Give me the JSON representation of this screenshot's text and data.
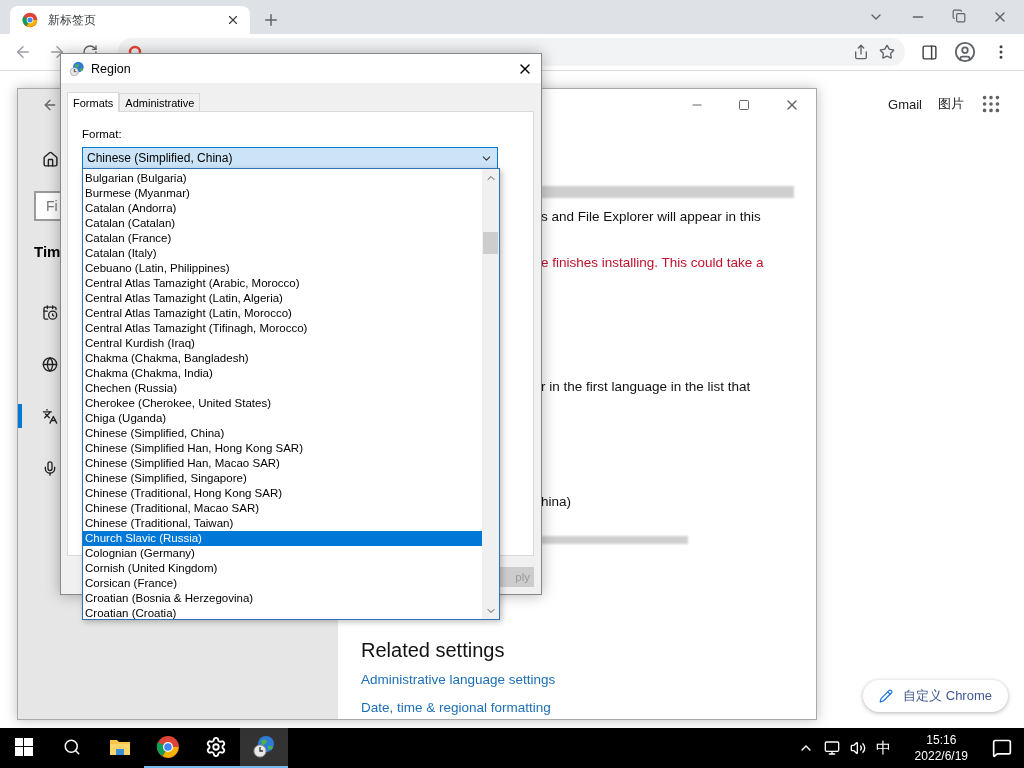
{
  "browser": {
    "tab": {
      "title": "新标签页",
      "selected": true
    },
    "top_links": [
      "Gmail",
      "图片"
    ],
    "customize_button": "自定义 Chrome"
  },
  "settings_window": {
    "search": {
      "placeholder": "Fi"
    },
    "heading": "Tim",
    "nav_items": [
      {
        "kind": "calendar",
        "selected": false
      },
      {
        "kind": "globe",
        "selected": false
      },
      {
        "kind": "language",
        "selected": true
      },
      {
        "kind": "microphone",
        "selected": false
      }
    ],
    "paragraphs": [
      {
        "text": "s and File Explorer will appear in this",
        "warning": false
      },
      {
        "text": "e finishes installing. This could take a",
        "warning": true
      },
      {
        "text": "r in the first language in the list that",
        "warning": false
      },
      {
        "text": "hina)",
        "warning": false
      }
    ],
    "related_settings": {
      "title": "Related settings",
      "links": [
        "Administrative language settings",
        "Date, time & regional formatting"
      ]
    }
  },
  "region_dialog": {
    "title": "Region",
    "tabs": [
      {
        "label": "Formats",
        "selected": true
      },
      {
        "label": "Administrative",
        "selected": false
      }
    ],
    "format_label": "Format:",
    "format_value": "Chinese (Simplified, China)",
    "apply_button": {
      "label": "ply",
      "disabled": true
    }
  },
  "format_list": [
    {
      "label": "Bulgarian (Bulgaria)",
      "selected": false
    },
    {
      "label": "Burmese (Myanmar)",
      "selected": false
    },
    {
      "label": "Catalan (Andorra)",
      "selected": false
    },
    {
      "label": "Catalan (Catalan)",
      "selected": false
    },
    {
      "label": "Catalan (France)",
      "selected": false
    },
    {
      "label": "Catalan (Italy)",
      "selected": false
    },
    {
      "label": "Cebuano (Latin, Philippines)",
      "selected": false
    },
    {
      "label": "Central Atlas Tamazight (Arabic, Morocco)",
      "selected": false
    },
    {
      "label": "Central Atlas Tamazight (Latin, Algeria)",
      "selected": false
    },
    {
      "label": "Central Atlas Tamazight (Latin, Morocco)",
      "selected": false
    },
    {
      "label": "Central Atlas Tamazight (Tifinagh, Morocco)",
      "selected": false
    },
    {
      "label": "Central Kurdish (Iraq)",
      "selected": false
    },
    {
      "label": "Chakma (Chakma, Bangladesh)",
      "selected": false
    },
    {
      "label": "Chakma (Chakma, India)",
      "selected": false
    },
    {
      "label": "Chechen (Russia)",
      "selected": false
    },
    {
      "label": "Cherokee (Cherokee, United States)",
      "selected": false
    },
    {
      "label": "Chiga (Uganda)",
      "selected": false
    },
    {
      "label": "Chinese (Simplified, China)",
      "selected": false
    },
    {
      "label": "Chinese (Simplified Han, Hong Kong SAR)",
      "selected": false
    },
    {
      "label": "Chinese (Simplified Han, Macao SAR)",
      "selected": false
    },
    {
      "label": "Chinese (Simplified, Singapore)",
      "selected": false
    },
    {
      "label": "Chinese (Traditional, Hong Kong SAR)",
      "selected": false
    },
    {
      "label": "Chinese (Traditional, Macao SAR)",
      "selected": false
    },
    {
      "label": "Chinese (Traditional, Taiwan)",
      "selected": false
    },
    {
      "label": "Church Slavic (Russia)",
      "selected": true
    },
    {
      "label": "Colognian (Germany)",
      "selected": false
    },
    {
      "label": "Cornish (United Kingdom)",
      "selected": false
    },
    {
      "label": "Corsican (France)",
      "selected": false
    },
    {
      "label": "Croatian (Bosnia & Herzegovina)",
      "selected": false
    },
    {
      "label": "Croatian (Croatia)",
      "selected": false
    }
  ],
  "taskbar": {
    "apps": [
      {
        "kind": "explorer",
        "running": false,
        "selected": false
      },
      {
        "kind": "chrome",
        "running": true,
        "selected": false
      },
      {
        "kind": "settings",
        "running": true,
        "selected": false
      },
      {
        "kind": "region",
        "running": true,
        "selected": true
      }
    ],
    "input_method": "中",
    "time": "15:16",
    "date": "2022/6/19"
  }
}
